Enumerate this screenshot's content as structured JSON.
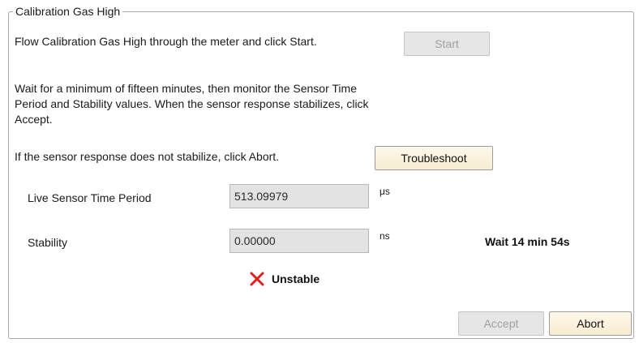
{
  "group": {
    "title": "Calibration Gas High"
  },
  "instructions": {
    "flow_text": "Flow Calibration Gas High through the meter and click Start.",
    "wait_line1": "Wait for a minimum of fifteen minutes, then monitor the Sensor Time",
    "wait_line2": "Period and Stability values. When the sensor response stabilizes, click",
    "wait_line3": "Accept.",
    "abort_text": "If the sensor response does not stabilize, click Abort."
  },
  "buttons": {
    "start": "Start",
    "troubleshoot": "Troubleshoot",
    "accept": "Accept",
    "abort": "Abort"
  },
  "readings": {
    "time_period_label": "Live Sensor Time Period",
    "time_period_value": "513.09979",
    "time_period_unit": "μs",
    "stability_label": "Stability",
    "stability_value": "0.00000",
    "stability_unit": "ns"
  },
  "status": {
    "wait_text": "Wait 14 min 54s",
    "stability_state": "Unstable",
    "icon": "red-x-icon"
  },
  "colors": {
    "error_icon": "#e0201c",
    "enabled_button_bg": "#f6ecd0",
    "disabled_button_bg": "#e6e6e6",
    "readonly_field_bg": "#e3e3e3"
  }
}
